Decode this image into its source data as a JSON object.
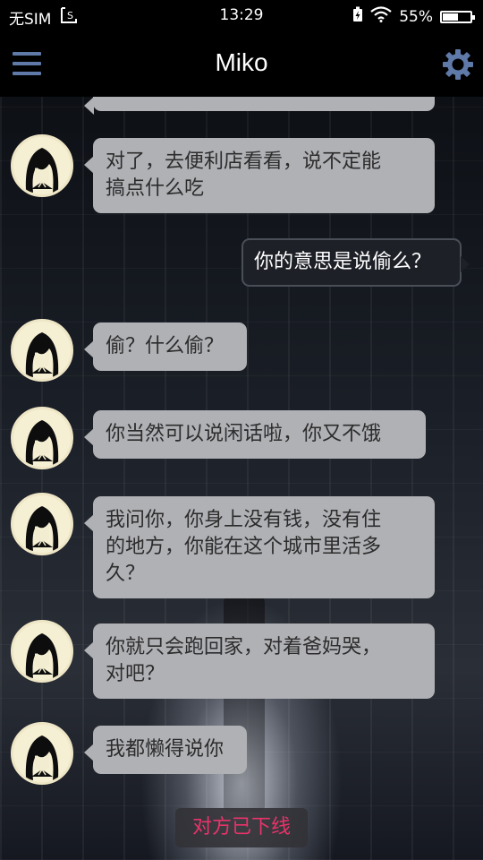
{
  "status_bar": {
    "carrier": "无SIM",
    "time": "13:29",
    "battery_percent_text": "55%",
    "battery_level": 0.55
  },
  "header": {
    "title": "Miko",
    "menu_icon": "hamburger-menu-icon",
    "settings_icon": "gear-icon"
  },
  "messages": [
    {
      "sender": "contact",
      "text": "对了，去便利店看看，说不定能\n搞点什么吃"
    },
    {
      "sender": "me",
      "text": "你的意思是说偷么？"
    },
    {
      "sender": "contact",
      "text": "偷？什么偷？"
    },
    {
      "sender": "contact",
      "text": "你当然可以说闲话啦，你又不饿"
    },
    {
      "sender": "contact",
      "text": "我问你，你身上没有钱，没有住\n的地方，你能在这个城市里活多\n久？"
    },
    {
      "sender": "contact",
      "text": "你就只会跑回家，对着爸妈哭，\n对吧？"
    },
    {
      "sender": "contact",
      "text": "我都懒得说你"
    }
  ],
  "footer": {
    "status_label": "对方已下线",
    "status_color": "#e8336a"
  },
  "colors": {
    "accent": "#5f7aa8",
    "incoming_bubble": "#b0b1b5",
    "outgoing_bubble": "#1d2027"
  }
}
